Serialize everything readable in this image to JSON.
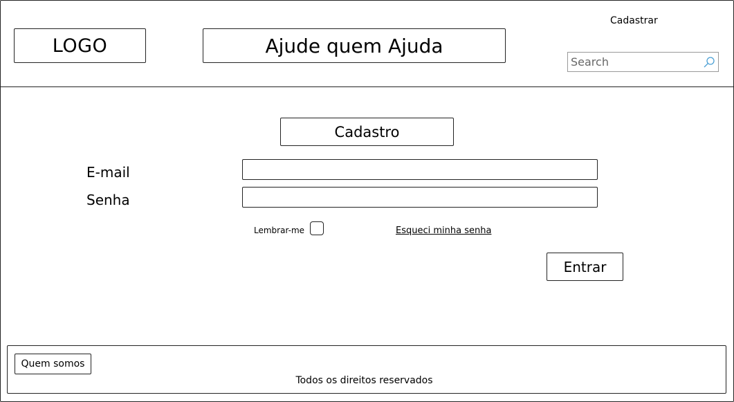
{
  "header": {
    "logo": "LOGO",
    "site_title": "Ajude quem Ajuda",
    "register_link": "Cadastrar",
    "search_placeholder": "Search",
    "search_icon": "search-icon"
  },
  "form": {
    "title": "Cadastro",
    "email_label": "E-mail",
    "email_value": "",
    "password_label": "Senha",
    "password_value": "",
    "remember_label": "Lembrar-me",
    "remember_checked": false,
    "forgot_link": "Esqueci minha senha",
    "submit_label": "Entrar"
  },
  "footer": {
    "about_link": "Quem somos",
    "copyright": "Todos os direitos reservados"
  }
}
